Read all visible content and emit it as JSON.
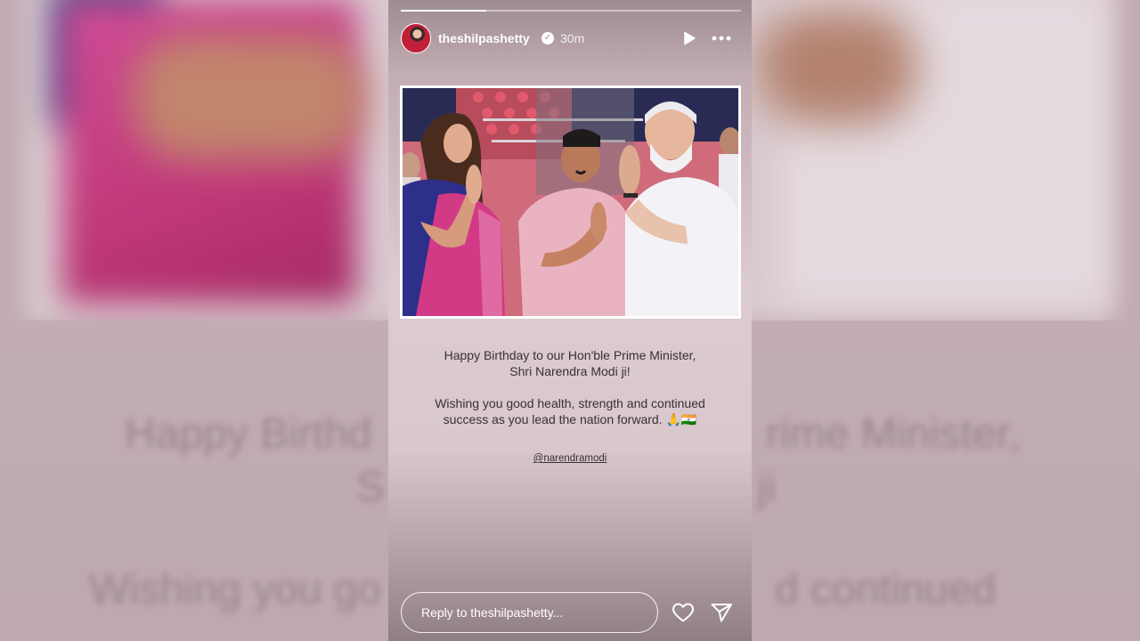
{
  "story": {
    "progress_fraction": 0.25,
    "author": {
      "username": "theshilpashetty",
      "time_ago": "30m"
    },
    "caption_lines": [
      "Happy Birthday to our Hon'ble Prime Minister, Shri Narendra Modi ji!",
      "Wishing you good health, strength and continued success as you lead the nation forward. 🙏🇮🇳"
    ],
    "mention": "@narendramodi",
    "reply": {
      "placeholder": "Reply to theshilpashetty..."
    }
  },
  "background": {
    "blurred_text_1": "Happy Birthd",
    "blurred_text_2": "rime Minister,",
    "blurred_text_3": "S",
    "blurred_text_4": "ji",
    "blurred_text_5": "Wishing you go",
    "blurred_text_6": "d continued"
  },
  "icons": {
    "play": "play-icon",
    "more": "more-icon",
    "verified": "verified-icon",
    "heart": "heart-icon",
    "send": "send-icon"
  },
  "colors": {
    "text_white": "#ffffff",
    "caption": "#3a3034",
    "saree": "#d33a86",
    "blouse": "#2d2f8a"
  }
}
